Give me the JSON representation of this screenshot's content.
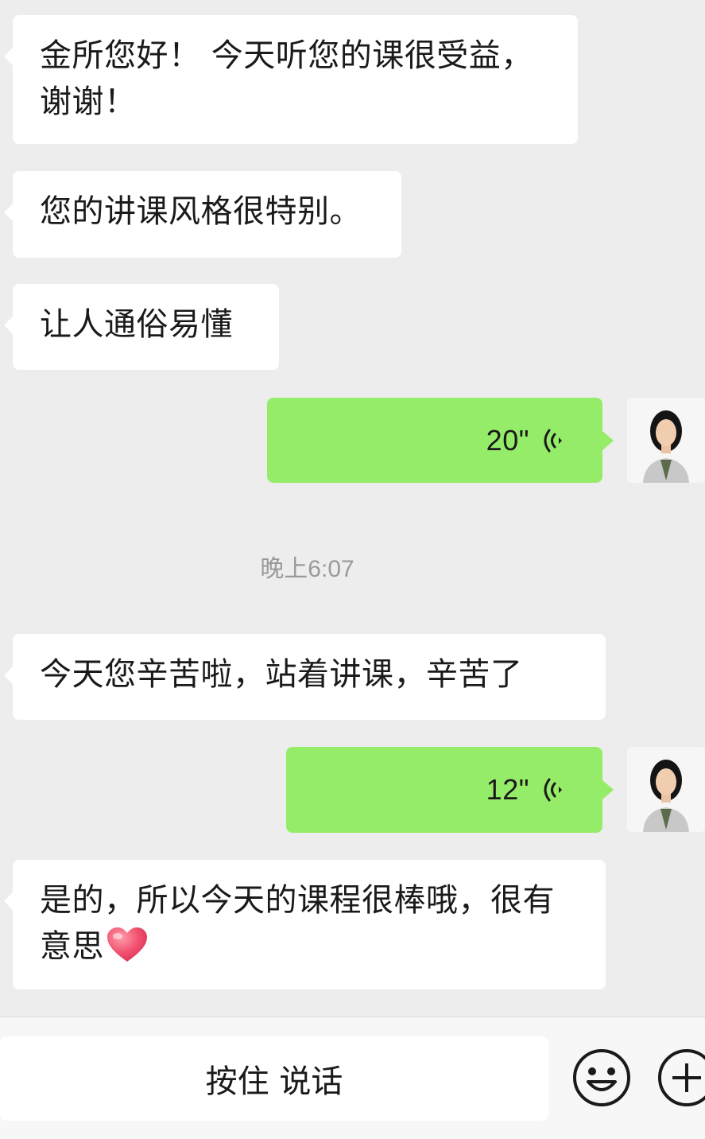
{
  "messages": [
    {
      "side": "in",
      "text": "金所您好！ 今天听您的课很受益，谢谢！"
    },
    {
      "side": "in",
      "text": "您的讲课风格很特别。"
    },
    {
      "side": "in",
      "text": "让人通俗易懂"
    },
    {
      "side": "out",
      "type": "voice",
      "duration": "20\""
    },
    {
      "side": "in",
      "text": "今天您辛苦啦，站着讲课，辛苦了"
    },
    {
      "side": "out",
      "type": "voice",
      "duration": "12\""
    },
    {
      "side": "in",
      "text": "是的，所以今天的课程很棒哦，很有意思",
      "emoji": "heart-icon"
    }
  ],
  "timestamp": "晚上6:07",
  "input_bar": {
    "hold_to_talk_label": "按住 说话",
    "icons": [
      "emoji-icon",
      "plus-icon"
    ]
  },
  "colors": {
    "background": "#ededed",
    "incoming_bubble": "#ffffff",
    "outgoing_bubble": "#95ec69",
    "timestamp_text": "#9a9a9a",
    "heart": "#f0506e"
  }
}
